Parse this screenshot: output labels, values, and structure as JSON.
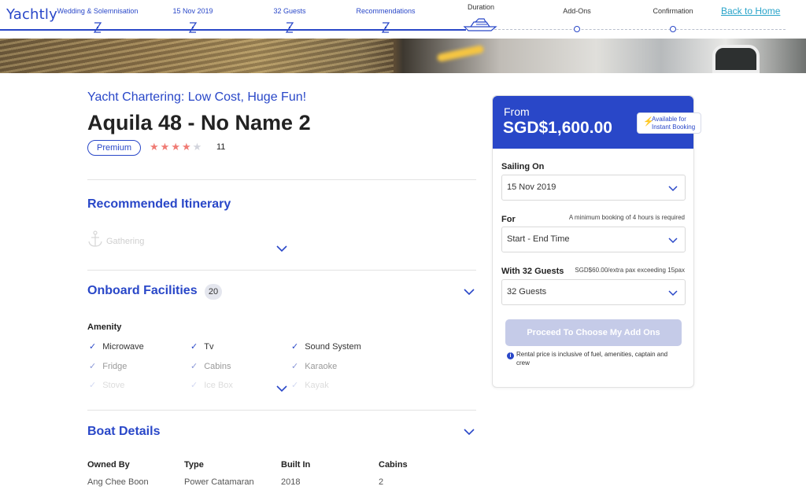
{
  "header": {
    "logo": "Yachtly",
    "back_home": "Back to Home",
    "steps": [
      {
        "label": "Wedding & Solemnisation"
      },
      {
        "label": "15 Nov 2019"
      },
      {
        "label": "32 Guests"
      },
      {
        "label": "Recommendations"
      },
      {
        "label": "Duration"
      },
      {
        "label": "Add-Ons"
      },
      {
        "label": "Confirmation"
      }
    ]
  },
  "listing": {
    "subtitle": "Yacht Chartering: Low Cost, Huge Fun!",
    "name": "Aquila 48 - No Name 2",
    "badge": "Premium",
    "rating": 4,
    "rating_max": 5,
    "review_count": "11"
  },
  "itinerary": {
    "title": "Recommended Itinerary",
    "first_item": "Gathering"
  },
  "facilities": {
    "title": "Onboard Facilities",
    "count": "20",
    "group_label": "Amenity",
    "items": [
      "Microwave",
      "Tv",
      "Sound System",
      "Fridge",
      "Cabins",
      "Karaoke",
      "Stove",
      "Ice Box",
      "Kayak"
    ]
  },
  "boat_details": {
    "title": "Boat Details",
    "fields": [
      {
        "label": "Owned By",
        "value": "Ang Chee Boon"
      },
      {
        "label": "Type",
        "value": "Power Catamaran"
      },
      {
        "label": "Built In",
        "value": "2018"
      },
      {
        "label": "Cabins",
        "value": "2"
      }
    ]
  },
  "booking": {
    "from_label": "From",
    "price": "SGD$1,600.00",
    "instant_line1": "Available for",
    "instant_line2": "Instant Booking",
    "sailing_label": "Sailing On",
    "sailing_value": "15 Nov 2019",
    "for_label": "For",
    "for_note": "A minimum booking of 4 hours is required",
    "for_value": "Start - End Time",
    "guests_label": "With 32 Guests",
    "guests_note": "SGD$60.00/extra pax exceeding 15pax",
    "guests_value": "32 Guests",
    "proceed_label": "Proceed To Choose My Add Ons",
    "info_text": "Rental price is inclusive of fuel, amenities, captain and crew"
  },
  "colors": {
    "brand": "#2947c8",
    "link": "#27a3c9",
    "star": "#f07b74",
    "disabled_button": "#c5cbe8"
  }
}
